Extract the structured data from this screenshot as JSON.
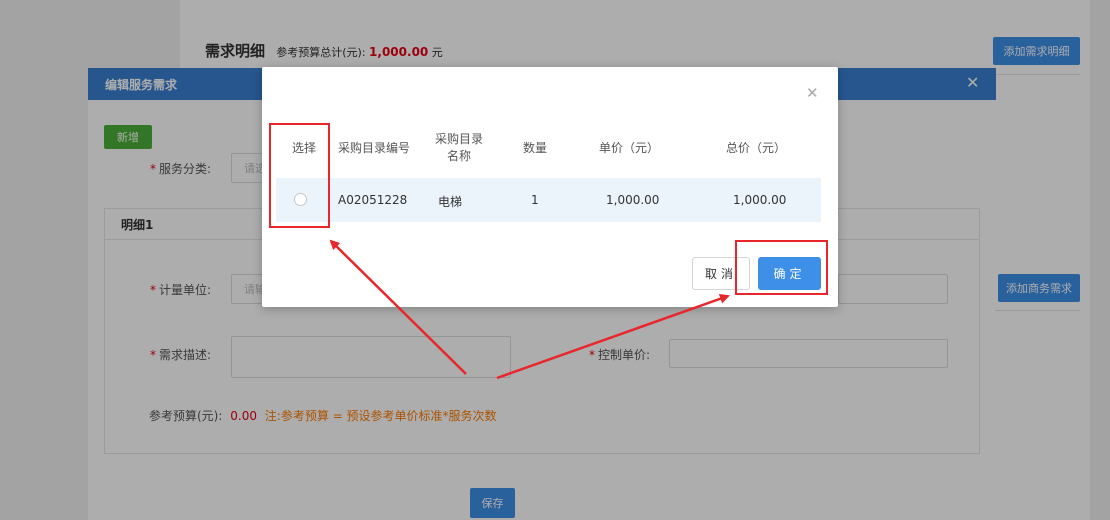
{
  "page": {
    "requirement_title": "需求明细",
    "budget_total_label": "参考预算总计(元):",
    "budget_total_value": "1,000.00",
    "budget_total_unit": "元",
    "add_requirement_button": "添加需求明细",
    "add_business_button": "添加商务需求"
  },
  "edit_modal": {
    "title": "编辑服务需求",
    "close_icon": "close-icon",
    "new_button": "新增",
    "service_category_label": "服务分类:",
    "service_category_placeholder": "请选",
    "detail_title": "明细1",
    "unit_label": "计量单位:",
    "unit_placeholder": "请输",
    "description_label": "需求描述:",
    "control_price_label": "控制单价:",
    "budget_label": "参考预算(元):",
    "budget_value": "0.00",
    "budget_note": "注:参考预算 = 预设参考单价标准*服务次数",
    "save_button": "保存"
  },
  "dialog": {
    "close_icon": "close-icon",
    "columns": [
      "选择",
      "采购目录编号",
      "采购目录名称",
      "数量",
      "单价（元）",
      "总价（元）"
    ],
    "column_name_line1": "采购目录",
    "column_name_line2": "名称",
    "rows": [
      {
        "selected": false,
        "code": "A02051228",
        "name": "电梯",
        "quantity": "1",
        "unit_price": "1,000.00",
        "total_price": "1,000.00"
      }
    ],
    "cancel_button": "取消",
    "confirm_button": "确定"
  },
  "annotation": {
    "color": "#e8262c"
  }
}
